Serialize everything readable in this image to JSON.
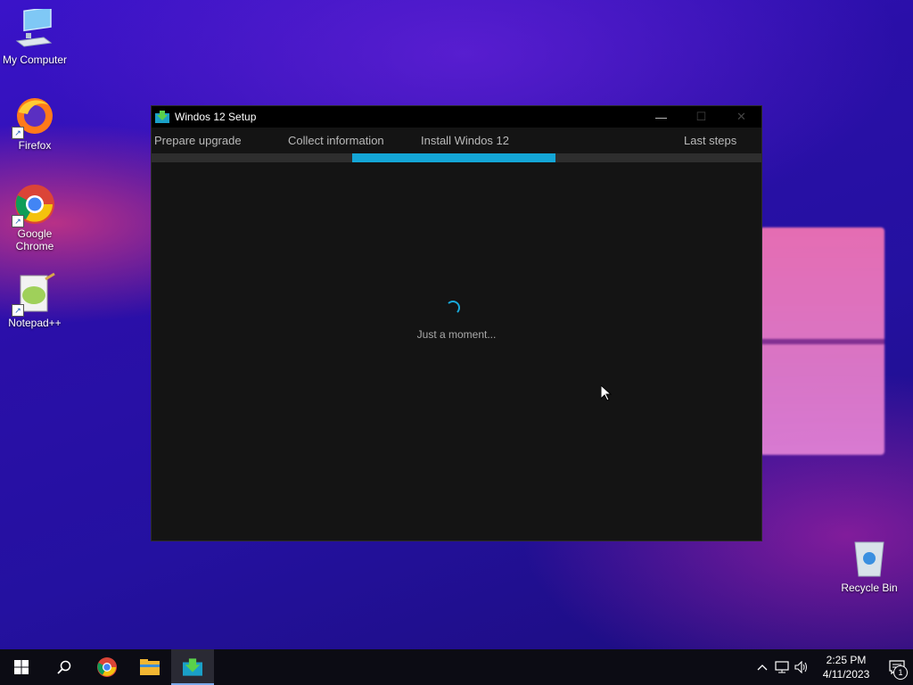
{
  "desktop": {
    "icons": [
      {
        "label": "My Computer"
      },
      {
        "label": "Firefox"
      },
      {
        "label": "Google Chrome"
      },
      {
        "label": "Notepad++"
      },
      {
        "label": "Recycle Bin"
      }
    ]
  },
  "window": {
    "title": "Windos 12 Setup",
    "controls": {
      "minimize": "—",
      "maximize": "☐",
      "close": "✕"
    },
    "steps": [
      {
        "label": "Prepare upgrade"
      },
      {
        "label": "Collect information"
      },
      {
        "label": "Install Windos 12",
        "active": true
      },
      {
        "label": "Last steps"
      }
    ],
    "status_text": "Just a moment...",
    "accent_color": "#14a6d6"
  },
  "taskbar": {
    "items": [
      "start-icon",
      "search-icon",
      "chrome-icon",
      "file-explorer-icon",
      "setup-app-icon"
    ],
    "clock": {
      "time": "2:25 PM",
      "date": "4/11/2023"
    },
    "notification_count": "1",
    "tray_icons": [
      "chevron-up-icon",
      "network-icon",
      "volume-icon"
    ]
  }
}
